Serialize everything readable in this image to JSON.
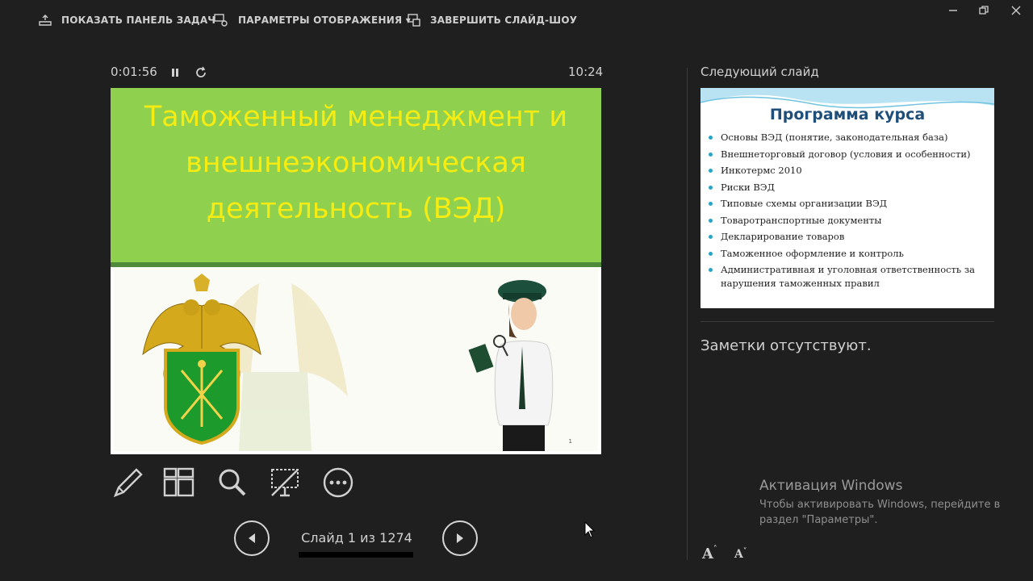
{
  "toolbar": {
    "show_taskbar": "ПОКАЗАТЬ ПАНЕЛЬ ЗАДАЧ",
    "display_settings": "ПАРАМЕТРЫ ОТОБРАЖЕНИЯ ▾",
    "end_slideshow": "ЗАВЕРШИТЬ СЛАЙД-ШОУ"
  },
  "presenter": {
    "elapsed": "0:01:56",
    "clock": "10:24"
  },
  "current_slide": {
    "title": "Таможенный менеджмент и внешнеэкономическая деятельность (ВЭД)",
    "slide_number": "1"
  },
  "navigation": {
    "counter": "Слайд 1 из 1274"
  },
  "next_slide": {
    "label": "Следующий слайд",
    "title": "Программа курса",
    "items": [
      "Основы ВЭД (понятие, законодательная база)",
      "Внешнеторговый договор (условия и особенности)",
      "Инкотермс 2010",
      "Риски ВЭД",
      "Типовые схемы организации ВЭД",
      "Товаротранспортные документы",
      "Декларирование товаров",
      "Таможенное оформление и контроль",
      "Административная и уголовная ответственность за нарушения таможенных правил"
    ]
  },
  "notes": {
    "text": "Заметки отсутствуют."
  },
  "activation": {
    "title": "Активация Windows",
    "text": "Чтобы активировать Windows, перейдите в раздел \"Параметры\"."
  },
  "font_controls": {
    "increase": "A",
    "decrease": "A"
  },
  "colors": {
    "background": "#1f1f1f",
    "slide_header_green": "#8fd14f",
    "slide_title_yellow": "#f7ec12",
    "bullet_blue": "#2aa3c9"
  }
}
